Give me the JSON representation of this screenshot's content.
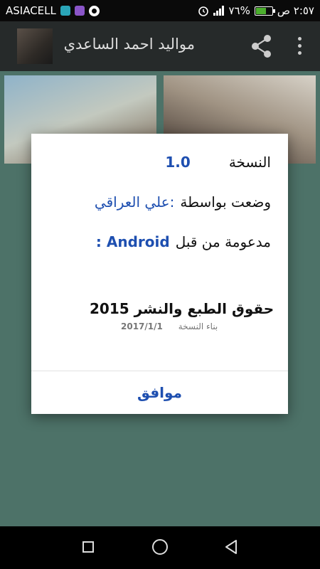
{
  "status_bar": {
    "carrier": "ASIACELL",
    "battery": "٧٦%",
    "time": "٢:٥٧ ص",
    "icons": [
      "mail-icon",
      "gallery-icon",
      "whatsapp-icon",
      "alarm-icon",
      "signal-icon",
      "battery-icon"
    ]
  },
  "app_bar": {
    "title": "مواليد احمد الساعدي",
    "share_icon": "share-icon",
    "menu_icon": "overflow-menu-icon"
  },
  "dialog": {
    "version_label": "النسخة",
    "version_value": "1.0",
    "author_label": "وضعت بواسطة",
    "author_value": ":علي العراقي",
    "supported_label": "مدعومة من قبل",
    "supported_value": "Android :",
    "copyright": "حقوق الطبع والنشر 2015",
    "build_label": "بناء النسخة",
    "build_date": "2017/1/1",
    "ok_label": "موافق"
  },
  "nav_bar": {
    "buttons": [
      "recents-icon",
      "home-icon",
      "back-icon"
    ]
  },
  "colors": {
    "accent": "#1e4fb0",
    "background": "#4d7268",
    "app_bar": "#262a2a"
  }
}
